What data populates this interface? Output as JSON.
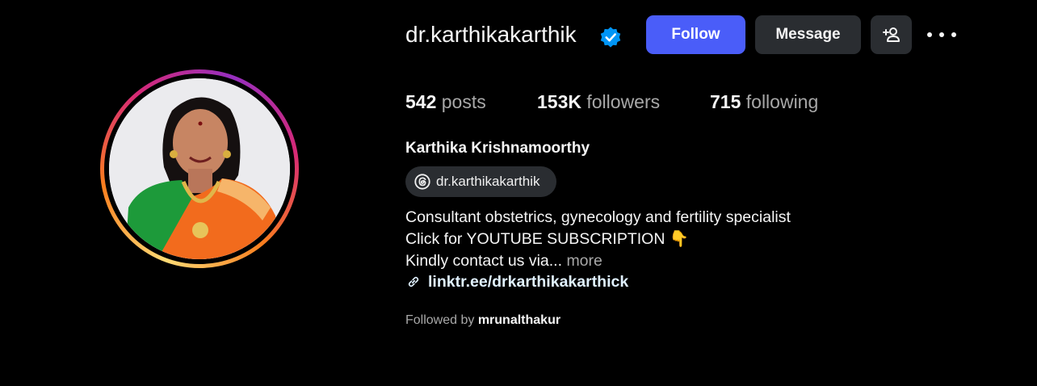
{
  "profile": {
    "username": "dr.karthikakarthik",
    "verified_icon": "verified-badge-icon",
    "full_name": "Karthika Krishnamoorthy",
    "threads_handle": "dr.karthikakarthik",
    "bio": {
      "line1": "Consultant obstetrics, gynecology and fertility specialist",
      "line2": "Click for YOUTUBE SUBSCRIPTION",
      "line2_emoji": "👇",
      "line3": "Kindly contact us via...",
      "more_label": "more"
    },
    "link": "linktr.ee/drkarthikakarthick",
    "followed_by_label": "Followed by",
    "followed_by_user": "mrunalthakur"
  },
  "actions": {
    "follow_label": "Follow",
    "message_label": "Message",
    "suggest_icon": "add-person-icon",
    "more_icon": "more-options-icon"
  },
  "stats": {
    "posts_count": "542",
    "posts_label": "posts",
    "followers_count": "153K",
    "followers_label": "followers",
    "following_count": "715",
    "following_label": "following"
  },
  "colors": {
    "background": "#000000",
    "follow_button": "#4a5df9",
    "secondary_button": "#2a2d31",
    "verified_badge": "#0095f6",
    "muted_text": "#a8a8a8"
  }
}
